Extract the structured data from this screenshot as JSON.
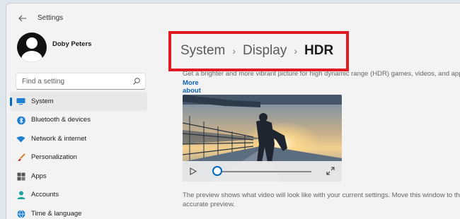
{
  "window": {
    "title": "Settings",
    "back_icon": "back-arrow-icon"
  },
  "user": {
    "name": "Doby Peters"
  },
  "search": {
    "placeholder": "Find a setting",
    "icon": "search-icon"
  },
  "sidebar": {
    "items": [
      {
        "label": "System",
        "icon": "monitor-icon",
        "active": true
      },
      {
        "label": "Bluetooth & devices",
        "icon": "bluetooth-icon"
      },
      {
        "label": "Network & internet",
        "icon": "wifi-icon"
      },
      {
        "label": "Personalization",
        "icon": "brush-icon"
      },
      {
        "label": "Apps",
        "icon": "apps-icon"
      },
      {
        "label": "Accounts",
        "icon": "person-icon"
      },
      {
        "label": "Time & language",
        "icon": "globe-icon"
      }
    ]
  },
  "breadcrumb": {
    "items": [
      "System",
      "Display",
      "HDR"
    ],
    "separator": "›"
  },
  "main": {
    "description": "Get a brighter and more vibrant picture for high dynamic range (HDR) games, videos, and apps.",
    "more_link": "More about HDR",
    "preview_note_line1": "The preview shows what video will look like with your current settings. Move this window to the",
    "preview_note_line2": "accurate preview."
  },
  "video": {
    "progress": 0.0,
    "play_icon": "play-icon",
    "fullscreen_icon": "fullscreen-icon"
  },
  "colors": {
    "accent": "#0067c0",
    "highlight": "#e01a22",
    "link": "#0d5fb4"
  }
}
